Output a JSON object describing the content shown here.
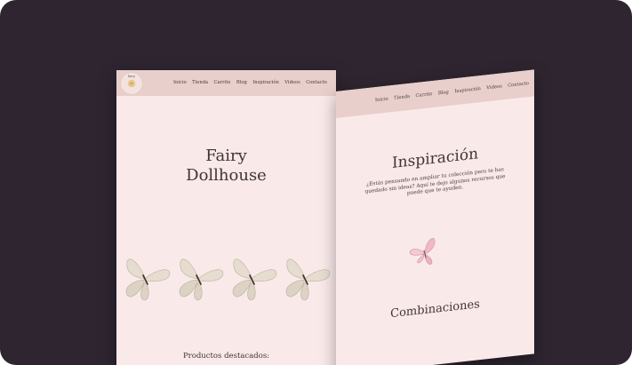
{
  "left_page": {
    "nav": {
      "logo_text": "fairy",
      "links": [
        "Inicio",
        "Tienda",
        "Carrito",
        "Blog",
        "Inspiración",
        "Videos",
        "Contacto"
      ]
    },
    "title_line1": "Fairy",
    "title_line2": "Dollhouse",
    "featured_label": "Productos destacados:",
    "butterfly_count": 4
  },
  "right_page": {
    "nav": {
      "links": [
        "Inicio",
        "Tienda",
        "Carrito",
        "Blog",
        "Inspiración",
        "Videos",
        "Contacto"
      ]
    },
    "title": "Inspiración",
    "description": "¿Estás pensando en ampliar tu colección pero te has quedado sin ideas? Aquí te dejo algunos recursos que puede que te ayuden.",
    "section_title": "Combinaciones"
  },
  "colors": {
    "background": "#2e2530",
    "page": "#f9e9e8",
    "nav": "#e8cfcb",
    "text": "#3f3634"
  }
}
